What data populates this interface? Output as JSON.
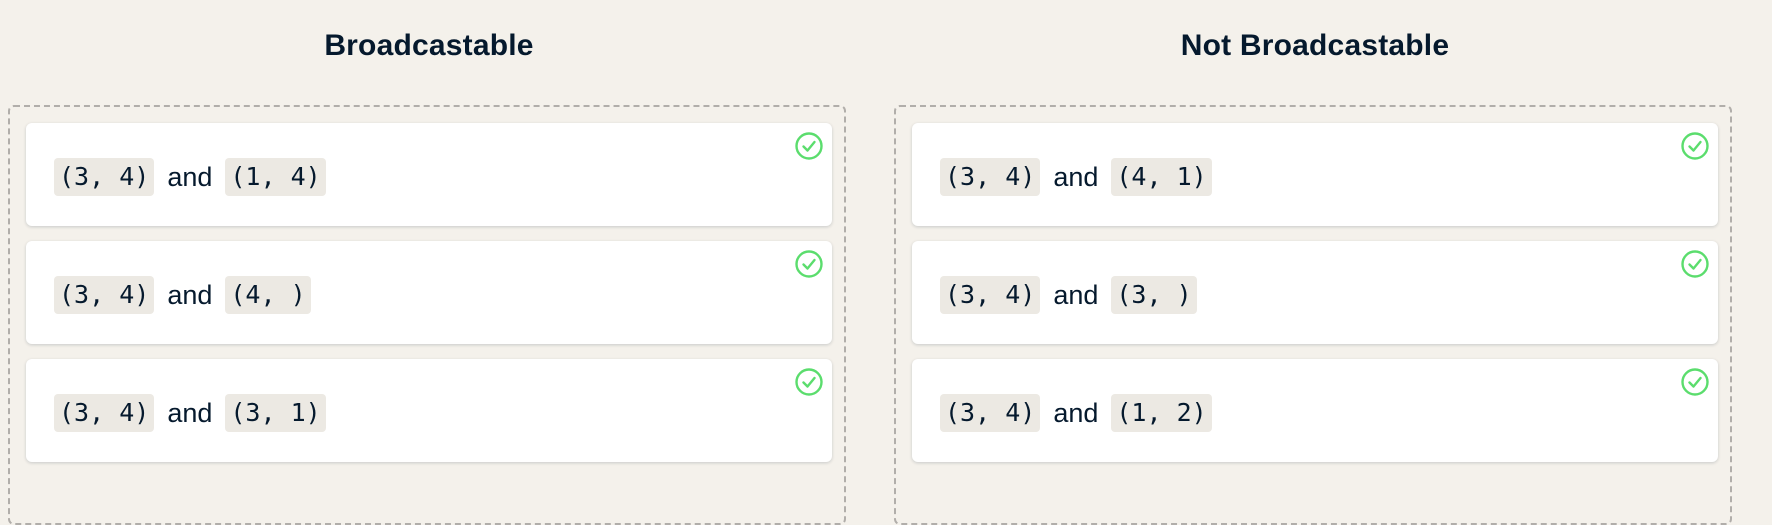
{
  "columns": [
    {
      "title": "Broadcastable",
      "items": [
        {
          "left": "(3, 4)",
          "joiner": "and",
          "right": "(1, 4)",
          "status": "correct"
        },
        {
          "left": "(3, 4)",
          "joiner": "and",
          "right": "(4, )",
          "status": "correct"
        },
        {
          "left": "(3, 4)",
          "joiner": "and",
          "right": "(3, 1)",
          "status": "correct"
        }
      ]
    },
    {
      "title": "Not Broadcastable",
      "items": [
        {
          "left": "(3, 4)",
          "joiner": "and",
          "right": "(4, 1)",
          "status": "correct"
        },
        {
          "left": "(3, 4)",
          "joiner": "and",
          "right": "(3, )",
          "status": "correct"
        },
        {
          "left": "(3, 4)",
          "joiner": "and",
          "right": "(1, 2)",
          "status": "correct"
        }
      ]
    }
  ],
  "colors": {
    "background": "#f4f1eb",
    "card": "#ffffff",
    "code_background": "#ece9e3",
    "text": "#05192d",
    "check": "#5bdd6d",
    "dashed_border": "#b1aeaa"
  },
  "icons": {
    "status": "check-circle-icon"
  }
}
